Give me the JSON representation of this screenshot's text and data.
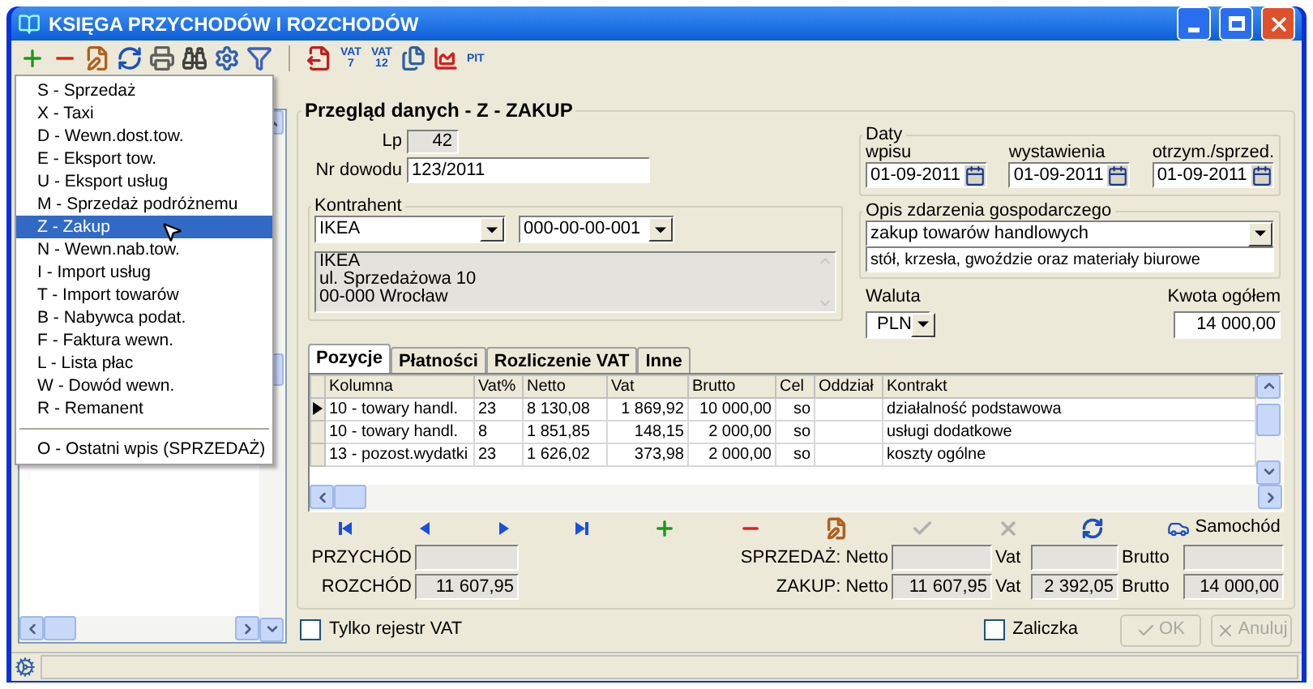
{
  "window": {
    "title": "KSIĘGA PRZYCHODÓW I ROZCHODÓW"
  },
  "toolbar": {
    "tools_left": [
      {
        "kind": "add"
      },
      {
        "kind": "delete"
      },
      {
        "kind": "edit"
      },
      {
        "kind": "refresh"
      },
      {
        "kind": "print"
      },
      {
        "kind": "find"
      },
      {
        "kind": "settings"
      },
      {
        "kind": "filter"
      }
    ],
    "tools_right": [
      {
        "kind": "export"
      },
      {
        "kind": "badge",
        "label": "VAT 7"
      },
      {
        "kind": "badge",
        "label": "VAT 12"
      },
      {
        "kind": "copy"
      },
      {
        "kind": "chart"
      },
      {
        "kind": "badge",
        "label": "PIT"
      }
    ]
  },
  "menu": {
    "items": [
      {
        "label": "S - Sprzedaż",
        "selected": false
      },
      {
        "label": "X - Taxi",
        "selected": false
      },
      {
        "label": "D - Wewn.dost.tow.",
        "selected": false
      },
      {
        "label": "E - Eksport tow.",
        "selected": false
      },
      {
        "label": "U - Eksport usług",
        "selected": false
      },
      {
        "label": "M - Sprzedaż podróżnemu",
        "selected": false
      },
      {
        "label": "Z - Zakup",
        "selected": true
      },
      {
        "label": "N - Wewn.nab.tow.",
        "selected": false
      },
      {
        "label": "I - Import usług",
        "selected": false
      },
      {
        "label": "T - Import towarów",
        "selected": false
      },
      {
        "label": "B - Nabywca podat.",
        "selected": false
      },
      {
        "label": "F - Faktura wewn.",
        "selected": false
      },
      {
        "label": "L - Lista płac",
        "selected": false
      },
      {
        "label": "W - Dowód wewn.",
        "selected": false
      },
      {
        "label": "R - Remanent",
        "selected": false
      }
    ],
    "extra_items": [
      {
        "label": "O - Ostatni wpis (SPRZEDAŻ)",
        "selected": false
      }
    ]
  },
  "form": {
    "title": "Przegląd danych - Z - ZAKUP",
    "lp": {
      "label": "Lp",
      "value": "42"
    },
    "nr_dowodu": {
      "label": "Nr dowodu",
      "value": "123/2011"
    },
    "kontrahent": {
      "legend": "Kontrahent",
      "name": "IKEA",
      "nip": "000-00-00-001",
      "address": [
        "IKEA",
        "ul. Sprzedażowa 10",
        "00-000 Wrocław"
      ]
    },
    "daty": {
      "legend": "Daty",
      "dates": [
        {
          "label": "wpisu",
          "value": "01-09-2011"
        },
        {
          "label": "wystawienia",
          "value": "01-09-2011"
        },
        {
          "label": "otrzym./sprzed.",
          "value": "01-09-2011"
        }
      ]
    },
    "opis": {
      "legend": "Opis zdarzenia gospodarczego",
      "category": "zakup towarów handlowych",
      "details": "stół, krzesła, gwoździe oraz materiały biurowe"
    },
    "waluta": {
      "label": "Waluta",
      "value": "PLN"
    },
    "kwota": {
      "label": "Kwota ogółem",
      "value": "14 000,00"
    }
  },
  "tabs": [
    {
      "label": "Pozycje",
      "selected": true
    },
    {
      "label": "Płatności",
      "selected": false
    },
    {
      "label": "Rozliczenie VAT",
      "selected": false
    },
    {
      "label": "Inne",
      "selected": false
    }
  ],
  "table": {
    "columns": [
      "Kolumna",
      "Vat%",
      "Netto",
      "Vat",
      "Brutto",
      "Cel",
      "Oddział",
      "Kontrakt"
    ],
    "rows": [
      {
        "selected": true,
        "cells": [
          "10 - towary handl.",
          "23",
          "8 130,08",
          "1 869,92",
          "10 000,00",
          "so",
          "",
          "działalność podstawowa"
        ]
      },
      {
        "selected": false,
        "cells": [
          "10 - towary handl.",
          "8",
          "1 851,85",
          "148,15",
          "2 000,00",
          "so",
          "",
          "usługi dodatkowe"
        ]
      },
      {
        "selected": false,
        "cells": [
          "13 - pozost.wydatki",
          "23",
          "1 626,02",
          "373,98",
          "2 000,00",
          "so",
          "",
          "koszty ogólne"
        ]
      }
    ]
  },
  "navigator": {
    "buttons": [
      {
        "kind": "first",
        "disabled": false
      },
      {
        "kind": "prev",
        "disabled": false
      },
      {
        "kind": "next",
        "disabled": false
      },
      {
        "kind": "last",
        "disabled": false
      },
      {
        "kind": "add",
        "disabled": false
      },
      {
        "kind": "delete",
        "disabled": false
      },
      {
        "kind": "edit",
        "disabled": false
      },
      {
        "kind": "confirm",
        "disabled": true
      },
      {
        "kind": "cancel",
        "disabled": true
      },
      {
        "kind": "refresh",
        "disabled": false
      }
    ],
    "car_button": "Samochód"
  },
  "totals": {
    "przychod": {
      "label": "PRZYCHÓD"
    },
    "rozchod": {
      "label": "ROZCHÓD",
      "value": "11 607,95"
    },
    "sprzedaz": {
      "label": "SPRZEDAŻ: Netto",
      "vat_label": "Vat",
      "brutto_label": "Brutto"
    },
    "zakup": {
      "label": "ZAKUP: Netto",
      "netto": "11 607,95",
      "vat_label": "Vat",
      "vat": "2 392,05",
      "brutto_label": "Brutto",
      "brutto": "14 000,00"
    }
  },
  "footer": {
    "vat_only": {
      "label": "Tylko rejestr VAT",
      "checked": false
    },
    "zaliczka": {
      "label": "Zaliczka",
      "checked": false
    },
    "buttons": [
      {
        "kind": "ok",
        "label": "OK",
        "disabled": true
      },
      {
        "kind": "cancel",
        "label": "Anuluj",
        "disabled": true
      }
    ]
  }
}
